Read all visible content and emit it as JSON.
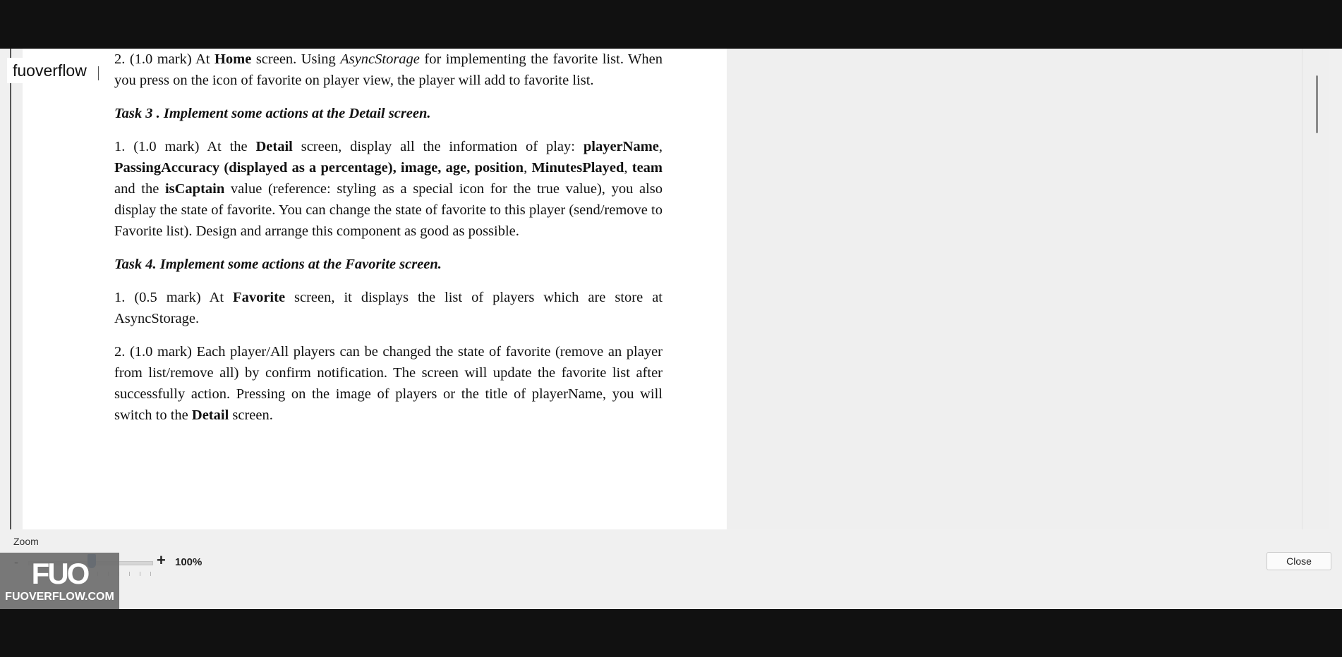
{
  "watermark": {
    "tag": "fuoverflow",
    "logo_mark": "FUO",
    "logo_text": "FUOVERFLOW.COM"
  },
  "document": {
    "paragraphs": [
      {
        "type": "text",
        "html": "2. (1.0 mark) At <b>Home</b> screen. Using <i>AsyncStorage</i> for implementing the favorite list. When you press on the icon of favorite on player view, the player will add to favorite list."
      },
      {
        "type": "task",
        "html": "Task 3 . Implement some actions at the Detail screen."
      },
      {
        "type": "text",
        "html": "1. (1.0 mark) At the <b>Detail</b> screen, display all the information of play: <b>playerName</b>, <b>PassingAccuracy (displayed as a percentage), image, age, position</b>, <b>MinutesPlayed</b>, <b>team</b> and the <b>isCaptain</b> value (reference: styling as a special icon for the true value), you also display the state of favorite. You can change the state of favorite to this player (send/remove to Favorite list). Design and arrange this component as good as possible."
      },
      {
        "type": "task",
        "html": "Task 4. Implement some actions at the Favorite screen."
      },
      {
        "type": "text",
        "html": "1. (0.5 mark) At <b>Favorite</b> screen, it displays the list of players which are store at AsyncStorage."
      },
      {
        "type": "text",
        "html": "2. (1.0 mark) Each player/All players can be changed the state of favorite (remove an player from list/remove all) by confirm notification. The screen will update the favorite list after successfully action. Pressing on the image of players or the title of playerName, you will switch to the <b>Detail</b> screen."
      }
    ]
  },
  "footer": {
    "zoom_label": "Zoom",
    "zoom_minus": "-",
    "zoom_plus": "+",
    "zoom_value": "100%",
    "zoom_level_percent": 100,
    "close_label": "Close"
  }
}
